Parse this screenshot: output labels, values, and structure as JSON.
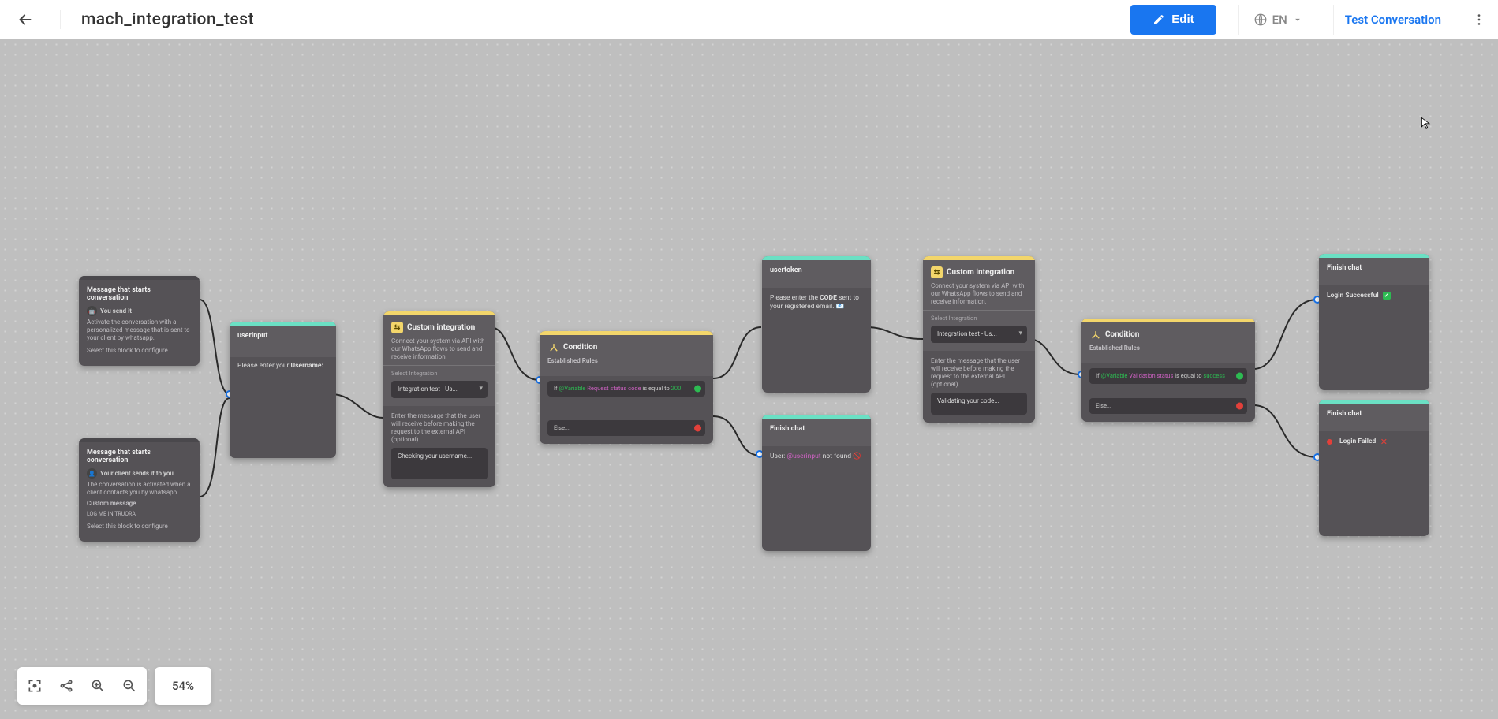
{
  "header": {
    "title": "mach_integration_test",
    "edit_label": "Edit",
    "lang_label": "EN",
    "test_conversation_label": "Test Conversation"
  },
  "bottom": {
    "zoom_label": "54%"
  },
  "nodes": {
    "start1": {
      "title": "Message that starts conversation",
      "badge": "You send it",
      "desc": "Activate the conversation with a personalized message that is sent to your client by whatsapp.",
      "hint": "Select this block to configure"
    },
    "start2": {
      "title": "Message that starts conversation",
      "badge": "Your client sends it to you",
      "desc": "The conversation is activated when a client contacts you by whatsapp.",
      "custom_label": "Custom message",
      "custom_value": "LOG ME IN TRUORA",
      "hint": "Select this block to configure"
    },
    "userinput": {
      "title": "userinput",
      "msg_prefix": "Please enter your",
      "msg_bold": "Username:"
    },
    "custom1": {
      "title": "Custom integration",
      "desc": "Connect your system via API with our WhatsApp flows to send and receive information.",
      "select_label": "Select Integration",
      "select_value": "Integration test - Us...",
      "hint": "Enter the message that the user will receive before making the request to the external API (optional).",
      "msg": "Checking your username..."
    },
    "cond1": {
      "title": "Condition",
      "sub": "Established Rules",
      "rule_if": "If ",
      "rule_var_prefix": "@Variable ",
      "rule_var": "Request status code",
      "rule_op": " is equal to ",
      "rule_val": "200",
      "else_label": "Else..."
    },
    "usertoken": {
      "title": "usertoken",
      "msg_a": "Please enter the ",
      "msg_b": "CODE",
      "msg_c": " sent to your registered email. 📧"
    },
    "finish_notfound": {
      "title": "Finish chat",
      "msg_a": "User: ",
      "msg_b": "@userinput",
      "msg_c": "  not found 🚫"
    },
    "custom2": {
      "title": "Custom integration",
      "desc": "Connect your system via API with our WhatsApp flows to send and receive information.",
      "select_label": "Select Integration",
      "select_value": "Integration test - Us...",
      "hint": "Enter the message that the user will receive before making the request to the external API (optional).",
      "msg": "Validating your code..."
    },
    "cond2": {
      "title": "Condition",
      "sub": "Established Rules",
      "rule_if": "If ",
      "rule_var_prefix": "@Variable ",
      "rule_var": "Validation status",
      "rule_op": " is equal to ",
      "rule_val": "success",
      "else_label": "Else..."
    },
    "finish_ok": {
      "title": "Finish chat",
      "msg": "Login Successful"
    },
    "finish_fail": {
      "title": "Finish chat",
      "msg": "Login Failed"
    }
  }
}
